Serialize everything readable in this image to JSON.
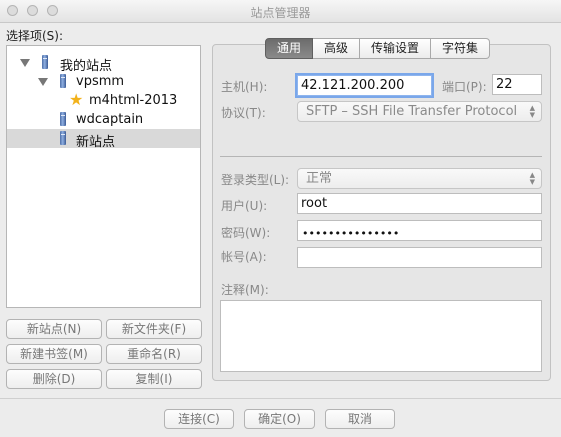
{
  "window": {
    "title": "站点管理器"
  },
  "sidebar": {
    "label": "选择项(S):",
    "tree": [
      {
        "label": "我的站点",
        "icon": "folder-server-icon",
        "expanded": true
      },
      {
        "label": "vpsmm",
        "icon": "server-icon",
        "expanded": true
      },
      {
        "label": "m4html-2013",
        "icon": "star-icon"
      },
      {
        "label": "wdcaptain",
        "icon": "server-icon"
      },
      {
        "label": "新站点",
        "icon": "server-icon",
        "selected": true
      }
    ],
    "buttons": {
      "new_site": "新站点(N)",
      "new_folder": "新文件夹(F)",
      "new_bookmark": "新建书签(M)",
      "rename": "重命名(R)",
      "delete": "删除(D)",
      "copy": "复制(I)"
    }
  },
  "tabs": [
    "通用",
    "高级",
    "传输设置",
    "字符集"
  ],
  "general": {
    "host_label": "主机(H):",
    "host_value": "42.121.200.200",
    "port_label": "端口(P):",
    "port_value": "22",
    "protocol_label": "协议(T):",
    "protocol_value": "SFTP – SSH File Transfer Protocol",
    "logon_type_label": "登录类型(L):",
    "logon_type_value": "正常",
    "user_label": "用户(U):",
    "user_value": "root",
    "password_label": "密码(W):",
    "password_mask": "•••••••••••••••",
    "account_label": "帐号(A):",
    "account_value": "",
    "comments_label": "注释(M):"
  },
  "footer": {
    "connect": "连接(C)",
    "ok": "确定(O)",
    "cancel": "取消"
  }
}
